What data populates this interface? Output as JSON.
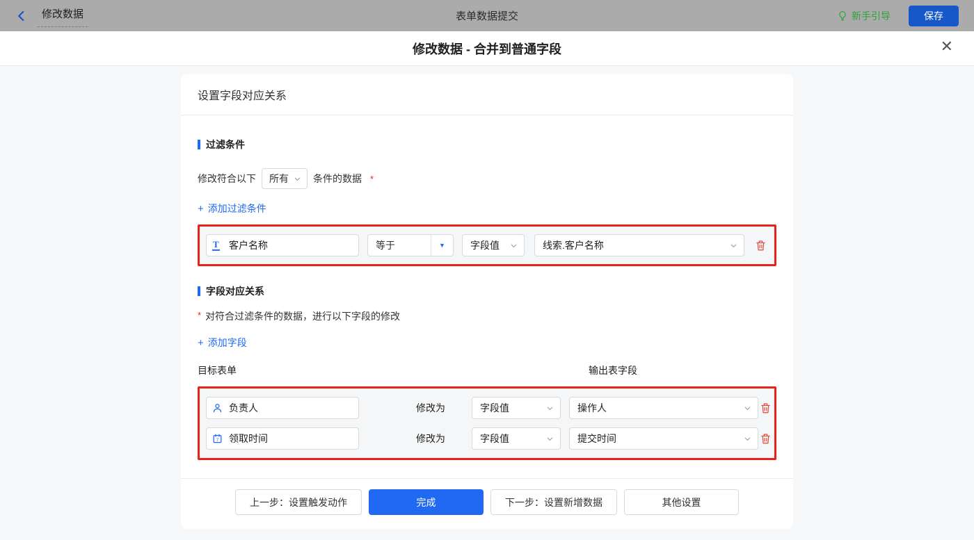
{
  "colors": {
    "topbar_bg": "#ababab",
    "accent_blue": "#2169f2",
    "save_blue": "#1657c9",
    "guide_green": "#2fa13c",
    "annotation_red": "#e8221a",
    "trash_red": "#e0483e"
  },
  "icons": {
    "plus_glyph": "+",
    "dropdown_triangle": "▼",
    "close_glyph": "✕"
  },
  "topbar": {
    "back_label": "修改数据",
    "center_title": "表单数据提交",
    "guide_label": "新手引导",
    "save_label": "保存"
  },
  "modal": {
    "title": "修改数据 - 合并到普通字段"
  },
  "panel": {
    "header": "设置字段对应关系",
    "filter_section": {
      "title": "过滤条件",
      "prefix": "修改符合以下",
      "match_select_value": "所有",
      "suffix": "条件的数据",
      "required_mark": "*",
      "add_link_label": "添加过滤条件",
      "condition": {
        "field": "客户名称",
        "operator": "等于",
        "value_type": "字段值",
        "value": "线索.客户名称"
      }
    },
    "mapping_section": {
      "title": "字段对应关系",
      "required_mark": "*",
      "description": "对符合过滤条件的数据，进行以下字段的修改",
      "add_link_label": "添加字段",
      "col_left": "目标表单",
      "col_right": "输出表字段",
      "rows": [
        {
          "field": "负责人",
          "modify_label": "修改为",
          "value_type": "字段值",
          "value": "操作人"
        },
        {
          "field": "领取时间",
          "modify_label": "修改为",
          "value_type": "字段值",
          "value": "提交时间"
        }
      ]
    },
    "footer": {
      "prev_label": "上一步：设置触发动作",
      "done_label": "完成",
      "next_label": "下一步：设置新增数据",
      "other_label": "其他设置"
    }
  }
}
